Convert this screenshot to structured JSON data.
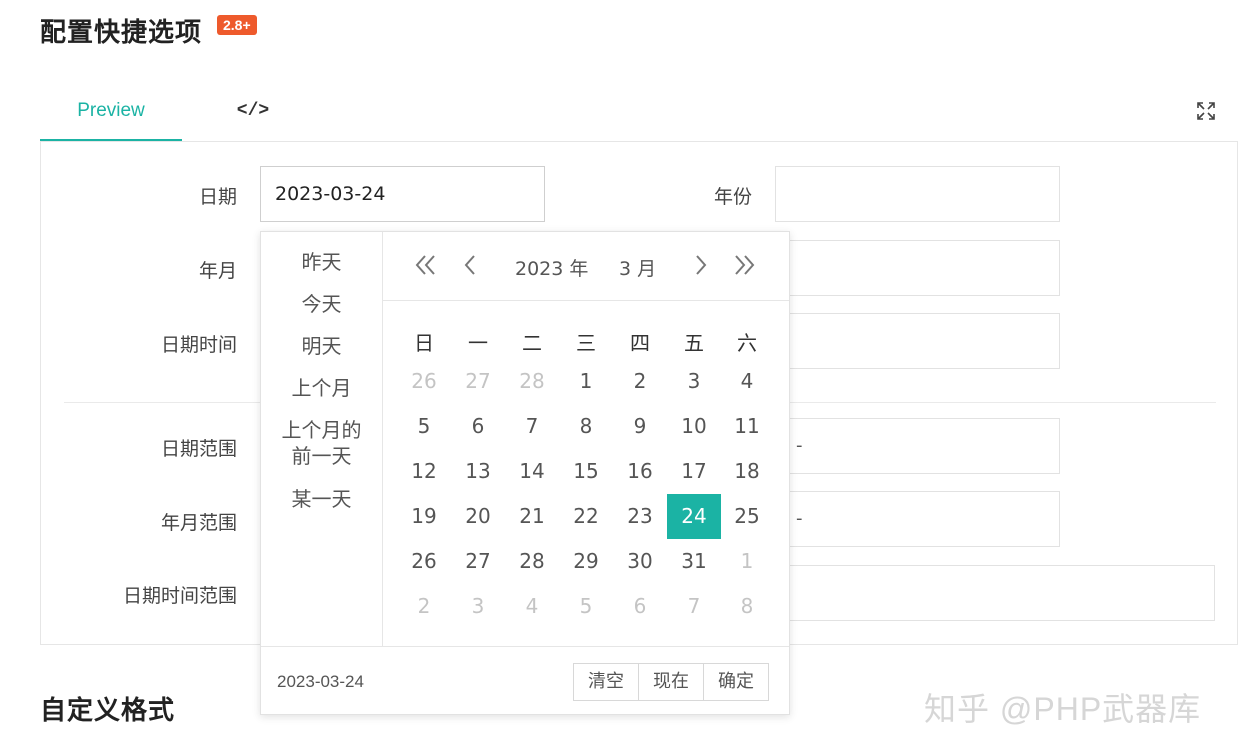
{
  "header": {
    "title": "配置快捷选项",
    "badge": "2.8+"
  },
  "tabs": [
    {
      "label": "Preview"
    },
    {
      "label": "</>"
    }
  ],
  "icons": {
    "fullscreen": "expand-icon",
    "prev_year": "double-chevron-left-icon",
    "prev_month": "chevron-left-icon",
    "next_month": "chevron-right-icon",
    "next_year": "double-chevron-right-icon"
  },
  "colors": {
    "accent": "#1bb3a4",
    "badge": "#ee5a2c"
  },
  "form": {
    "date": {
      "label": "日期",
      "value": "2023-03-24"
    },
    "year": {
      "label": "年份",
      "value": ""
    },
    "year_month": {
      "label": "年月",
      "value": ""
    },
    "datetime": {
      "label": "日期时间",
      "value": ""
    },
    "date_range": {
      "label": "日期范围",
      "separator": "-"
    },
    "month_range": {
      "label": "年月范围",
      "separator": "-"
    },
    "datetime_range": {
      "label": "日期时间范围",
      "value": ""
    }
  },
  "picker": {
    "shortcuts": [
      "昨天",
      "今天",
      "明天",
      "上个月",
      "上个月的前一天",
      "某一天"
    ],
    "shortcut_lines": [
      [
        "昨天"
      ],
      [
        "今天"
      ],
      [
        "明天"
      ],
      [
        "上个月"
      ],
      [
        "上个月的",
        "前一天"
      ],
      [
        "某一天"
      ]
    ],
    "year_label": "2023 年",
    "month_label": "3 月",
    "weekdays": [
      "日",
      "一",
      "二",
      "三",
      "四",
      "五",
      "六"
    ],
    "weeks": [
      [
        "26",
        "27",
        "28",
        "1",
        "2",
        "3",
        "4"
      ],
      [
        "5",
        "6",
        "7",
        "8",
        "9",
        "10",
        "11"
      ],
      [
        "12",
        "13",
        "14",
        "15",
        "16",
        "17",
        "18"
      ],
      [
        "19",
        "20",
        "21",
        "22",
        "23",
        "24",
        "25"
      ],
      [
        "26",
        "27",
        "28",
        "29",
        "30",
        "31",
        "1"
      ],
      [
        "2",
        "3",
        "4",
        "5",
        "6",
        "7",
        "8"
      ]
    ],
    "other_month": [
      [
        true,
        true,
        true,
        false,
        false,
        false,
        false
      ],
      [
        false,
        false,
        false,
        false,
        false,
        false,
        false
      ],
      [
        false,
        false,
        false,
        false,
        false,
        false,
        false
      ],
      [
        false,
        false,
        false,
        false,
        false,
        false,
        false
      ],
      [
        false,
        false,
        false,
        false,
        false,
        false,
        true
      ],
      [
        true,
        true,
        true,
        true,
        true,
        true,
        true
      ]
    ],
    "selected_day": "24",
    "footer_value": "2023-03-24",
    "buttons": {
      "clear": "清空",
      "now": "现在",
      "confirm": "确定"
    }
  },
  "section2": {
    "title": "自定义格式"
  },
  "watermark": "知乎 @PHP武器库"
}
